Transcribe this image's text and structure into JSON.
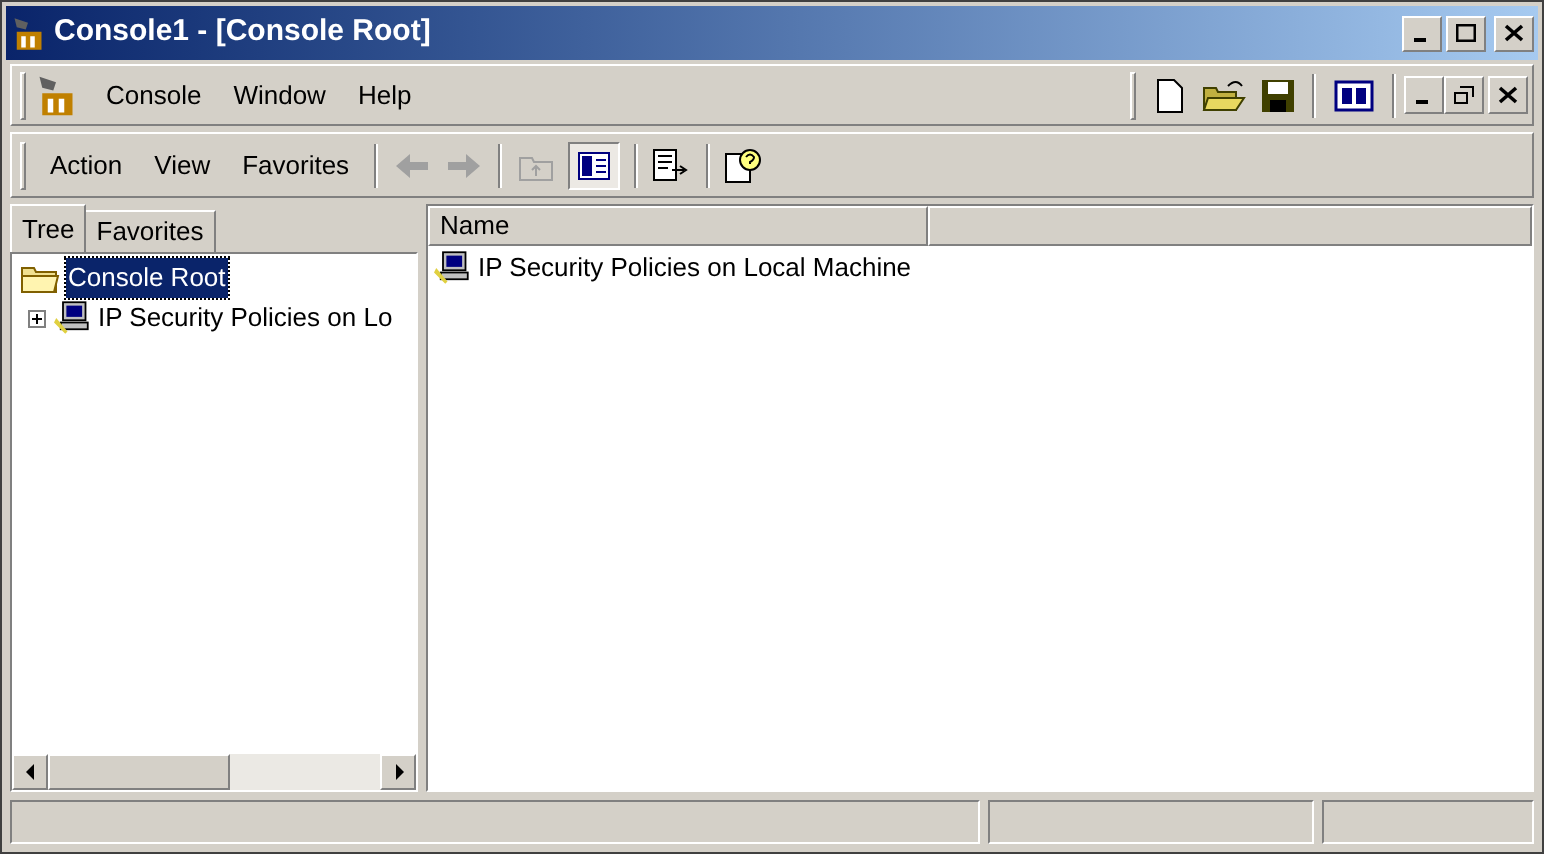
{
  "window": {
    "title": "Console1 - [Console Root]"
  },
  "menu": [
    {
      "label": "Console"
    },
    {
      "label": "Window"
    },
    {
      "label": "Help"
    }
  ],
  "action_menu": [
    {
      "label": "Action"
    },
    {
      "label": "View"
    },
    {
      "label": "Favorites"
    }
  ],
  "toolbar": [
    {
      "kind": "back",
      "disabled": true
    },
    {
      "kind": "forward",
      "disabled": true
    },
    {
      "kind": "sep"
    },
    {
      "kind": "up",
      "disabled": true
    },
    {
      "kind": "tree",
      "pressed": true
    },
    {
      "kind": "sep"
    },
    {
      "kind": "export",
      "disabled": false
    },
    {
      "kind": "sep"
    },
    {
      "kind": "help",
      "disabled": false
    }
  ],
  "tabs": [
    {
      "label": "Tree",
      "selected": true
    },
    {
      "label": "Favorites",
      "selected": false
    }
  ],
  "tree": [
    {
      "label": "Console Root",
      "selected": true,
      "expanded": true,
      "children": [
        {
          "label": "IP Security Policies on Lo",
          "selected": false,
          "expanded": false
        }
      ]
    }
  ],
  "table": {
    "columns": [
      "Name"
    ],
    "rows": [
      {
        "name": "IP Security Policies on Local Machine"
      }
    ]
  }
}
